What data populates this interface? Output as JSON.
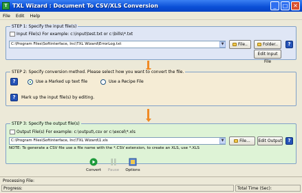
{
  "window": {
    "title": "TXL Wizard : Document To CSV/XLS Conversion",
    "app_icon_text": "T"
  },
  "window_buttons": [
    "_",
    "□",
    "✕"
  ],
  "menu": [
    "File",
    "Edit",
    "Help"
  ],
  "step1": {
    "title": "STEP 1: Specify the input file(s)",
    "label": "Input File(s) For example: c:\\input\\test.txt or c:\\bills\\*.txt",
    "path": "C:\\Program Files\\Softinterface, Inc\\TXL Wizard\\ErrorLog.txt",
    "file_btn": "File..",
    "folder_btn": "Folder..",
    "edit_btn": "Edit Input File"
  },
  "step2": {
    "title": "STEP 2: Specify conversion method.  Please select how you want to convert the file.",
    "option_marked": "Use a Marked up text file",
    "option_recipe": "Use a Recipe File",
    "markup_text": "Mark up the input file(s) by editing."
  },
  "step3": {
    "title": "STEP 3: Specify the output file(s)",
    "label": "Output File(s) For example: c:\\output\\.csv or c:\\excel\\*.xls",
    "path": "C:\\Program Files\\Softinterface, Inc\\TXL Wizard\\1.xls",
    "file_btn": "File...",
    "edit_btn": "Edit Output",
    "note": "NOTE: To generate a CSV file use a file name with the *.CSV extension, to create an XLS, use *.XLS"
  },
  "toolbar": {
    "convert": "Convert",
    "pause": "Pause",
    "options": "Options"
  },
  "status": {
    "processing": "Processing File:",
    "progress": "Progress:",
    "total_time": "Total Time (Sec):"
  },
  "help_glyph": "?"
}
